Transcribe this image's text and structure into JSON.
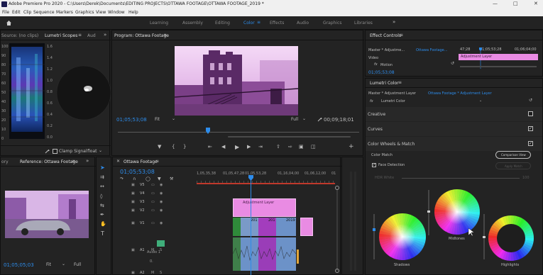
{
  "window": {
    "title": "Adobe Premiere Pro 2020 - C:\\Users\\Derek\\Documents\\EDITING PROJECTS\\OTTAWA FOOTAGE\\OTTAWA FOOTAGE_2019 *"
  },
  "menu": [
    "File",
    "Edit",
    "Clip",
    "Sequence",
    "Markers",
    "Graphics",
    "View",
    "Window",
    "Help"
  ],
  "workspaces": [
    "Learning",
    "Assembly",
    "Editing",
    "Color",
    "Effects",
    "Audio",
    "Graphics",
    "Libraries"
  ],
  "workspace_active": "Color",
  "scopes": {
    "tab_source": "Source: (no clips)",
    "tab_scopes": "Lumetri Scopes",
    "tab_audio": "Aud",
    "left_scale": [
      "100",
      "90",
      "80",
      "70",
      "60",
      "50",
      "40",
      "30",
      "20",
      "10",
      "0"
    ],
    "right_scale": [
      "1.6",
      "1.4",
      "1.2",
      "1.0",
      "0.8",
      "0.6",
      "0.4",
      "0.2",
      "0.0"
    ],
    "clamp_label": "Clamp Signal",
    "float_label": "float"
  },
  "program": {
    "tab": "Program: Ottawa Footage",
    "timecode": "01;05;53;08",
    "fit": "Fit",
    "quality": "Full",
    "duration": "00;09;18;01"
  },
  "effect_controls": {
    "tab": "Effect Controls",
    "master": "Master * Adjustme...",
    "seq": "Ottawa Footage...",
    "video_label": "Video",
    "motion_label": "Motion",
    "ruler_marks": [
      "47;28",
      "01;05;53;28",
      "01;06;04;00"
    ],
    "clip_label": "Adjustment Layer",
    "timecode": "01;05;53;08"
  },
  "lumetri_color": {
    "tab": "Lumetri Color",
    "master": "Master * Adjustment Layer",
    "seq": "Ottawa Footage * Adjustment Layer",
    "fx_label": "Lumetri Color",
    "sections": [
      "Creative",
      "Curves",
      "Color Wheels & Match"
    ],
    "color_match": "Color Match",
    "comparison_view": "Comparison View",
    "face_detection": "Face Detection",
    "apply_match": "Apply Match",
    "hsl_label": "HDR White",
    "hsl_value": "100",
    "wheels": [
      "Shadows",
      "Midtones",
      "Highlights"
    ]
  },
  "reference": {
    "tab_prev": "ory",
    "tab": "Reference: Ottawa Footage",
    "timecode": "01;05;05;03",
    "fit": "Fit",
    "quality": "Full"
  },
  "timeline": {
    "tab": "Ottawa Footage",
    "timecode": "01;05;53;08",
    "ruler": [
      "1,05,35,38",
      "01,05,47,28",
      "01,05,53,28",
      "01,16,04,00",
      "01,06,12,00",
      "01"
    ],
    "tracks": [
      "V5",
      "V4",
      "V3",
      "V2",
      "V1",
      "A1",
      "A2"
    ],
    "audio_track_name": "Audio 1",
    "audio_level": "0.",
    "adjustment_clip": "Adjustment Layer",
    "clip_labels": [
      "201",
      "201",
      "2019"
    ]
  },
  "colors": {
    "accent": "#2d8ceb",
    "clip_pink": "#e98be3",
    "clip_purple": "#a33dbd",
    "clip_green": "#2f8a3a",
    "audio_green": "#3f7f4a"
  }
}
